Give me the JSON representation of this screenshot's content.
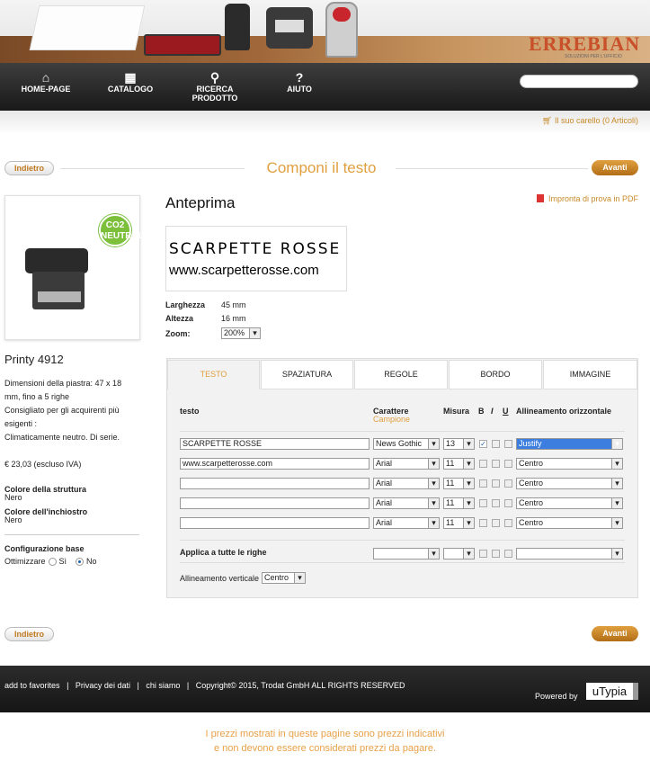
{
  "banner": {
    "logo": "ERREBIAN",
    "logo_tagline": "SOLUZIONI PER L'UFFICIO"
  },
  "nav": {
    "items": [
      {
        "label": "HOME-PAGE",
        "icon": "home-icon"
      },
      {
        "label": "CATALOGO",
        "icon": "book-icon"
      },
      {
        "label": "RICERCA PRODOTTO",
        "icon": "search-icon"
      },
      {
        "label": "AIUTO",
        "icon": "question-icon"
      }
    ],
    "search_placeholder": ""
  },
  "cart": {
    "label": "Il suo carello (0 Articoli)"
  },
  "wizard": {
    "back_label": "Indietro",
    "next_label": "Avanti",
    "title": "Componi il testo"
  },
  "product": {
    "name": "Printy 4912",
    "description": "Dimensioni della piastra: 47 x 18 mm, fino a 5 righe\nConsigliato per gli acquirenti più esigenti :\nClimaticamente neutro. Di serie.",
    "price": "€ 23,03 (escluso IVA)",
    "structure_color_label": "Colore della struttura",
    "structure_color": "Nero",
    "ink_color_label": "Colore dell'inchiostro",
    "ink_color": "Nero",
    "config_label": "Configurazione base",
    "optimize_label": "Ottimizzare",
    "option_yes": "Sì",
    "option_no": "No",
    "optimize_selected": "No",
    "badge": "CO2 NEUTRAL"
  },
  "preview": {
    "title": "Anteprima",
    "pdf_link": "Impronta di prova in PDF",
    "line1": "SCARPETTE ROSSE",
    "line2": "www.scarpetterosse.com",
    "width_label": "Larghezza",
    "width": "45 mm",
    "height_label": "Altezza",
    "height": "16 mm",
    "zoom_label": "Zoom:",
    "zoom": "200%"
  },
  "tabs": [
    {
      "label": "TESTO"
    },
    {
      "label": "SPAZIATURA"
    },
    {
      "label": "REGOLE"
    },
    {
      "label": "BORDO"
    },
    {
      "label": "IMMAGINE"
    }
  ],
  "editor": {
    "col_text": "testo",
    "col_font": "Carattere",
    "col_font_sub": "Campione",
    "col_size": "Misura",
    "col_b": "B",
    "col_i": "I",
    "col_u": "U",
    "col_align": "Allineamento orizzontale",
    "rows": [
      {
        "text": "SCARPETTE ROSSE",
        "font": "News Gothic",
        "size": "13",
        "b": true,
        "align": "Justify"
      },
      {
        "text": "www.scarpetterosse.com",
        "font": "Arial",
        "size": "11",
        "b": false,
        "align": "Centro"
      },
      {
        "text": "",
        "font": "Arial",
        "size": "11",
        "b": false,
        "align": "Centro"
      },
      {
        "text": "",
        "font": "Arial",
        "size": "11",
        "b": false,
        "align": "Centro"
      },
      {
        "text": "",
        "font": "Arial",
        "size": "11",
        "b": false,
        "align": "Centro"
      }
    ],
    "apply_all_label": "Applica a tutte le righe",
    "vertical_align_label": "Allineamento verticale",
    "vertical_align": "Centro"
  },
  "footer": {
    "links": [
      "add to favorites",
      "Privacy dei dati",
      "chi siamo"
    ],
    "copyright": "Copyright© 2015, Trodat GmbH ALL RIGHTS RESERVED",
    "powered_by": "Powered by",
    "brand": "uTypia"
  },
  "disclaimer": {
    "line1": "I prezzi mostrati in queste pagine sono prezzi indicativi",
    "line2": "e non devono essere considerati prezzi da pagare."
  },
  "colors": {
    "accent": "#e0a040",
    "nav_bg": "#1f1f1f",
    "link": "#c88a2a"
  }
}
